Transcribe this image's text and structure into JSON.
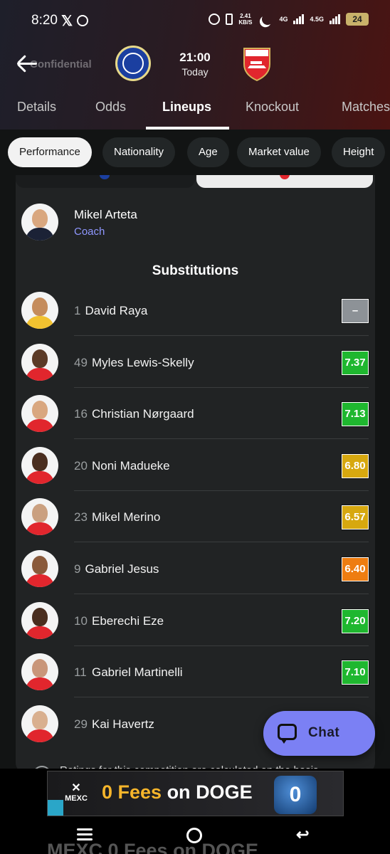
{
  "status_bar": {
    "time": "8:20",
    "net_speed_top": "2.41",
    "net_speed_bottom": "KB/S",
    "network_1": "4G",
    "network_2": "4.5G",
    "battery": "24"
  },
  "header": {
    "back_label": "Confidential",
    "home_team_crest": "chelsea-crest",
    "away_team_crest": "arsenal-crest",
    "home_crest_text": "CHELSEA",
    "away_crest_text": "Arsenal",
    "kickoff_time": "21:00",
    "kickoff_day": "Today"
  },
  "tabs": [
    {
      "label": "Details"
    },
    {
      "label": "Odds"
    },
    {
      "label": "Lineups",
      "active": true
    },
    {
      "label": "Knockout"
    },
    {
      "label": "Matches"
    }
  ],
  "filters": [
    {
      "label": "Performance",
      "active": true
    },
    {
      "label": "Nationality"
    },
    {
      "label": "Age"
    },
    {
      "label": "Market value"
    },
    {
      "label": "Height"
    }
  ],
  "coach": {
    "name": "Mikel Arteta",
    "role": "Coach"
  },
  "substitutions": {
    "title": "Substitutions",
    "players": [
      {
        "number": "1",
        "name": "David Raya",
        "rating": "–",
        "rating_color": "#8d9297",
        "skin": "#c58c5c",
        "shirt": "#f2c230"
      },
      {
        "number": "49",
        "name": "Myles Lewis-Skelly",
        "rating": "7.37",
        "rating_color": "#1fb72f",
        "skin": "#5b3a26",
        "shirt": "#e1262d"
      },
      {
        "number": "16",
        "name": "Christian Nørgaard",
        "rating": "7.13",
        "rating_color": "#1fb72f",
        "skin": "#d9a77f",
        "shirt": "#e1262d"
      },
      {
        "number": "20",
        "name": "Noni Madueke",
        "rating": "6.80",
        "rating_color": "#d7a80f",
        "skin": "#4a2e1f",
        "shirt": "#e1262d"
      },
      {
        "number": "23",
        "name": "Mikel Merino",
        "rating": "6.57",
        "rating_color": "#d7a80f",
        "skin": "#caa080",
        "shirt": "#e1262d"
      },
      {
        "number": "9",
        "name": "Gabriel Jesus",
        "rating": "6.40",
        "rating_color": "#ee7d11",
        "skin": "#8a5a3b",
        "shirt": "#e1262d"
      },
      {
        "number": "10",
        "name": "Eberechi Eze",
        "rating": "7.20",
        "rating_color": "#1fb72f",
        "skin": "#4a2e1f",
        "shirt": "#e1262d"
      },
      {
        "number": "11",
        "name": "Gabriel Martinelli",
        "rating": "7.10",
        "rating_color": "#1fb72f",
        "skin": "#c9967a",
        "shirt": "#e1262d"
      },
      {
        "number": "29",
        "name": "Kai Havertz",
        "rating": "",
        "rating_color": "#1fb72f",
        "skin": "#d9b08f",
        "shirt": "#e1262d"
      }
    ]
  },
  "info_note": "Ratings for this competition are calculated on the basis",
  "chat": {
    "label": "Chat"
  },
  "ad": {
    "brand": "MEXC",
    "headline_prefix": "0 Fees ",
    "headline_mid": "on ",
    "headline_suffix": "DOGE",
    "coin_text": "0",
    "ghost_text": "MEXC 0 Fees on DOGE"
  },
  "colors": {
    "accent": "#7b80f4",
    "coach_role": "#8f97ff",
    "panel": "#212324",
    "background": "#121414"
  }
}
